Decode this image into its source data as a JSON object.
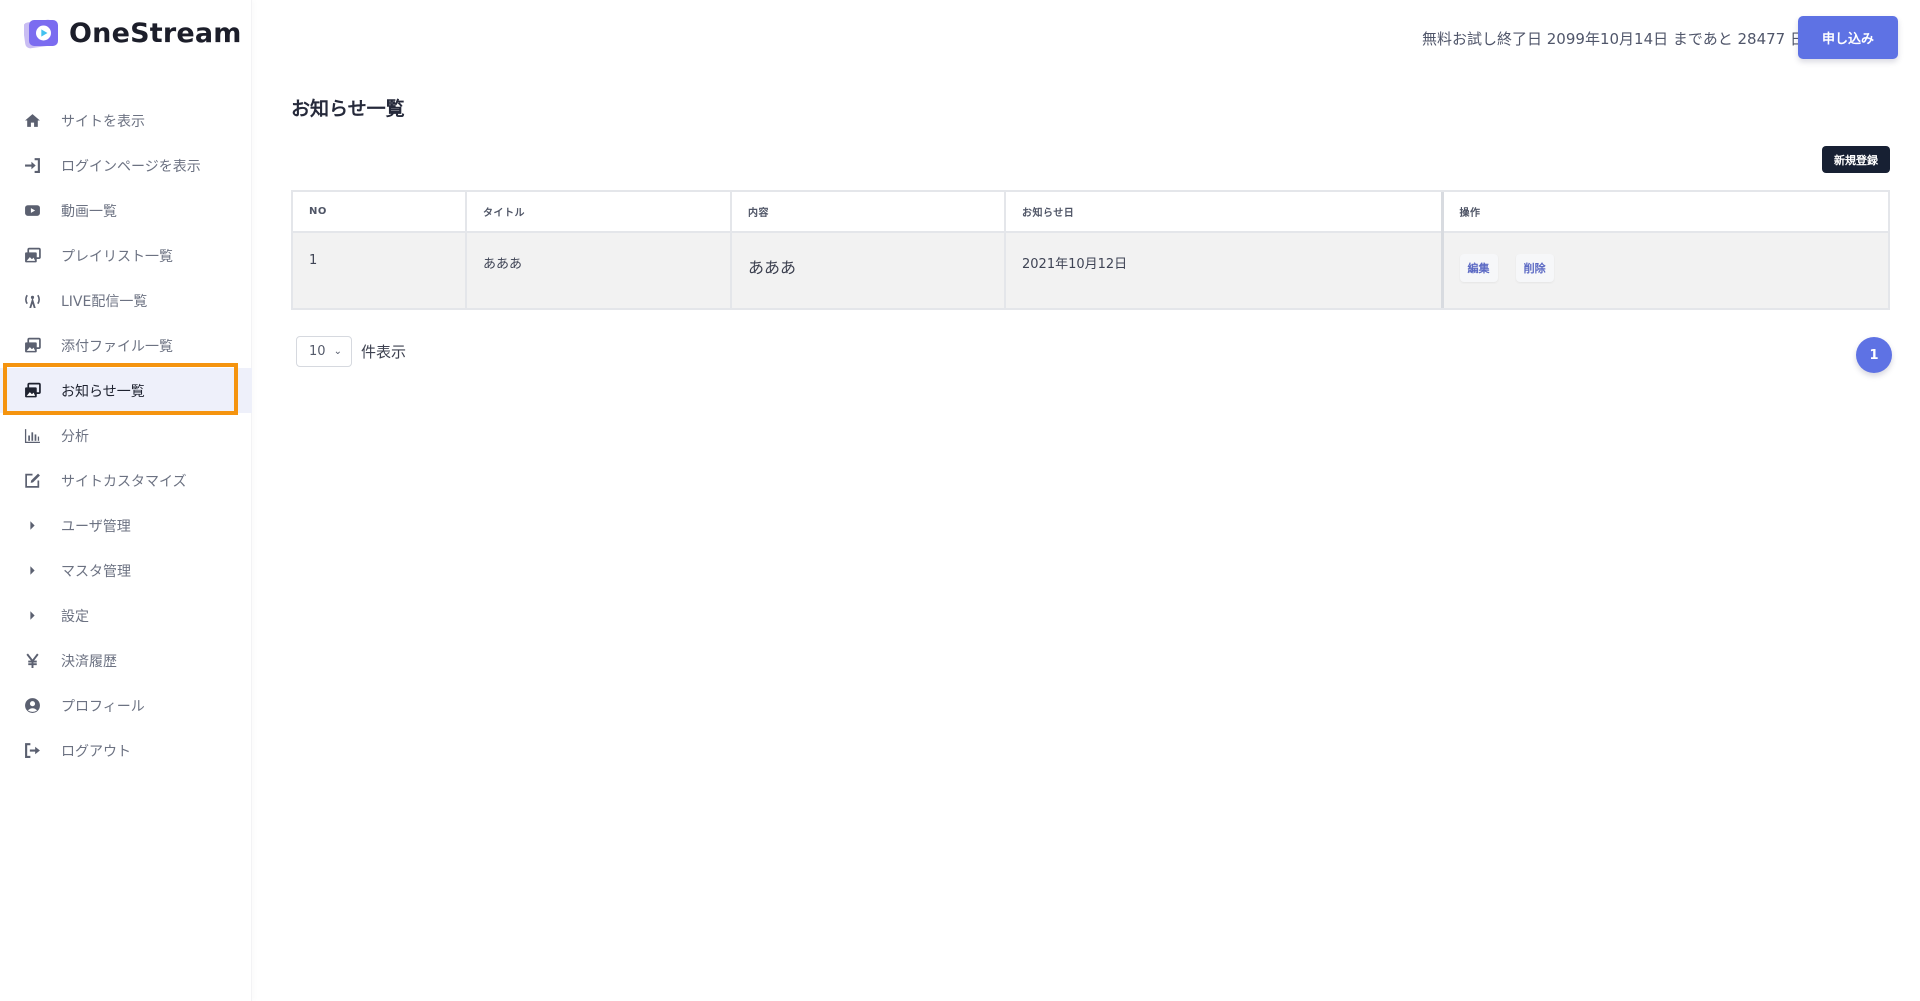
{
  "app": {
    "logo_text": "OneStream"
  },
  "sidebar": {
    "items": [
      {
        "label": "サイトを表示",
        "icon": "home-icon"
      },
      {
        "label": "ログインページを表示",
        "icon": "sign-in-icon"
      },
      {
        "label": "動画一覧",
        "icon": "youtube-play-icon"
      },
      {
        "label": "プレイリスト一覧",
        "icon": "images-icon"
      },
      {
        "label": "LIVE配信一覧",
        "icon": "broadcast-tower-icon"
      },
      {
        "label": "添付ファイル一覧",
        "icon": "images-icon"
      },
      {
        "label": "お知らせ一覧",
        "icon": "images-icon",
        "active": true
      },
      {
        "label": "分析",
        "icon": "chart-bar-icon"
      },
      {
        "label": "サイトカスタマイズ",
        "icon": "edit-icon"
      },
      {
        "label": "ユーザ管理",
        "icon": "caret-right-icon"
      },
      {
        "label": "マスタ管理",
        "icon": "caret-right-icon"
      },
      {
        "label": "設定",
        "icon": "caret-right-icon"
      },
      {
        "label": "決済履歴",
        "icon": "yen-icon"
      },
      {
        "label": "プロフィール",
        "icon": "user-circle-icon"
      },
      {
        "label": "ログアウト",
        "icon": "sign-out-icon"
      }
    ],
    "highlight_color": "#f5940f"
  },
  "header": {
    "trial_text": "無料お試し終了日 2099年10月14日 まであと 28477 日",
    "apply_label": "申し込み",
    "accent_color": "#5e72e4"
  },
  "main": {
    "title": "お知らせ一覧",
    "new_label": "新規登録",
    "table": {
      "columns": [
        "NO",
        "タイトル",
        "内容",
        "お知らせ日",
        "操作"
      ],
      "rows": [
        {
          "no": "1",
          "title": "あああ",
          "content": "あああ",
          "date": "2021年10月12日",
          "edit_label": "編集",
          "delete_label": "削除"
        }
      ]
    },
    "page_size": {
      "value": "10",
      "label": "件表示"
    },
    "pagination": {
      "current": "1"
    }
  }
}
